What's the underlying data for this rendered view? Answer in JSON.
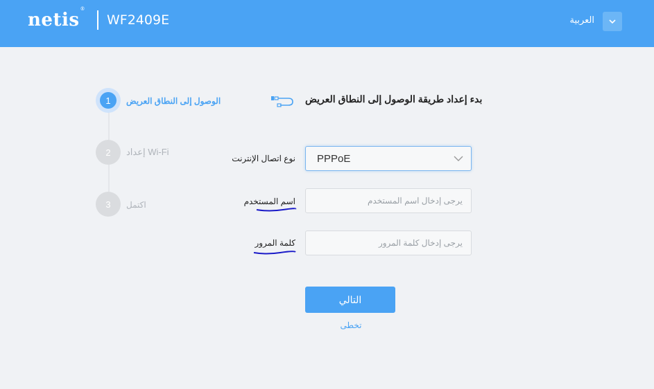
{
  "header": {
    "brand": "netis",
    "brand_mark": "®",
    "model": "WF2409E",
    "language": "العربية",
    "language_dropdown_icon": "chevron-down-icon",
    "colors": {
      "bar": "#4aa3f4"
    }
  },
  "stepper": {
    "steps": [
      {
        "number": "1",
        "label": "الوصول إلى النطاق العريض",
        "active": true
      },
      {
        "number": "2",
        "label": "إعداد Wi-Fi",
        "active": false
      },
      {
        "number": "3",
        "label": "اكتمل",
        "active": false
      }
    ]
  },
  "main": {
    "title": "بدء إعداد طريقة الوصول إلى النطاق العريض",
    "title_icon": "ethernet-cable-icon",
    "connection_type_label": "نوع اتصال الإنترنت",
    "connection_type_value": "PPPoE",
    "username_label": "اسم المستخدم",
    "username_placeholder": "يرجى إدخال اسم المستخدم",
    "password_label": "كلمة المرور",
    "password_placeholder": "يرجى إدخال كلمة المرور",
    "next_button": "التالي",
    "skip_link": "تخطى",
    "colors": {
      "accent": "#4aa3f4",
      "annotation_underline": "#1a1ac8"
    }
  }
}
